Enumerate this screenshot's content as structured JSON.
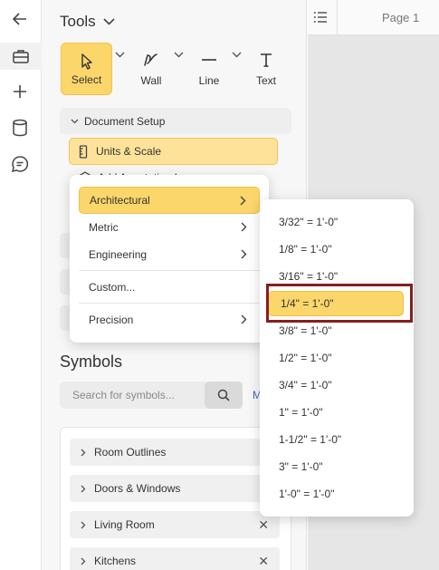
{
  "toolbar": {
    "title": "Tools",
    "tools": [
      {
        "label": "Select",
        "icon": "cursor-icon"
      },
      {
        "label": "Wall",
        "icon": "wall-icon"
      },
      {
        "label": "Line",
        "icon": "line-icon"
      },
      {
        "label": "Text",
        "icon": "text-icon"
      }
    ]
  },
  "document_setup": {
    "label": "Document Setup",
    "items": [
      {
        "label": "Units & Scale",
        "icon": "ruler-icon"
      },
      {
        "label": "Add Annotation Layer",
        "icon": "layers-icon"
      }
    ]
  },
  "units_menu": {
    "items": [
      {
        "label": "Architectural",
        "has_submenu": true
      },
      {
        "label": "Metric",
        "has_submenu": true
      },
      {
        "label": "Engineering",
        "has_submenu": true
      },
      {
        "label": "Custom...",
        "has_submenu": false
      },
      {
        "label": "Precision",
        "has_submenu": true
      }
    ],
    "selected": "Architectural"
  },
  "scale_submenu": {
    "items": [
      "3/32\" = 1'-0\"",
      "1/8\" = 1'-0\"",
      "3/16\" = 1'-0\"",
      "1/4\" = 1'-0\"",
      "3/8\" = 1'-0\"",
      "1/2\" = 1'-0\"",
      "3/4\" = 1'-0\"",
      "1\" = 1'-0\"",
      "1-1/2\" = 1'-0\"",
      "3\" = 1'-0\"",
      "1'-0\" = 1'-0\""
    ],
    "selected": "1/4\" = 1'-0\""
  },
  "symbols": {
    "title": "Symbols",
    "search_placeholder": "Search for symbols...",
    "more_link": "M",
    "categories": [
      {
        "label": "Room Outlines",
        "removable": false
      },
      {
        "label": "Doors & Windows",
        "removable": false
      },
      {
        "label": "Living Room",
        "removable": true
      },
      {
        "label": "Kitchens",
        "removable": true
      }
    ]
  },
  "canvas": {
    "page_label": "Page 1"
  },
  "colors": {
    "accent": "#fbd66b",
    "accent_border": "#f0c04a",
    "highlight_outline": "#8a1c1c",
    "link": "#3a68c8"
  }
}
